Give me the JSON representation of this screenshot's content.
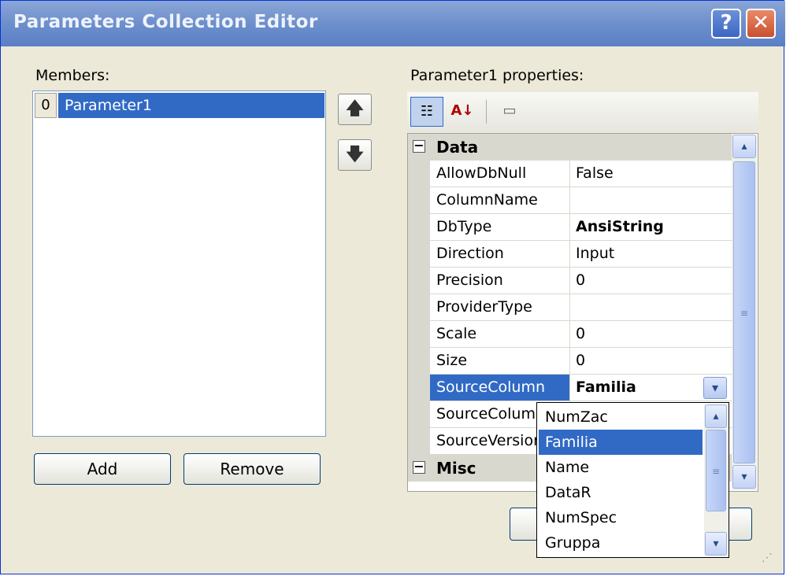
{
  "window": {
    "title": "Parameters Collection Editor",
    "help_glyph": "?",
    "close_glyph": "✕"
  },
  "members": {
    "label": "Members:",
    "items": [
      {
        "index": "0",
        "name": "Parameter1"
      }
    ],
    "add_label": "Add",
    "remove_label": "Remove"
  },
  "properties": {
    "label": "Parameter1 properties:",
    "categories": [
      {
        "name": "Data",
        "toggle": "⊟"
      },
      {
        "name": "Misc",
        "toggle": "⊟"
      }
    ],
    "rows": [
      {
        "name": "AllowDbNull",
        "value": "False"
      },
      {
        "name": "ColumnName",
        "value": ""
      },
      {
        "name": "DbType",
        "value": "AnsiString"
      },
      {
        "name": "Direction",
        "value": "Input"
      },
      {
        "name": "Precision",
        "value": "0"
      },
      {
        "name": "ProviderType",
        "value": ""
      },
      {
        "name": "Scale",
        "value": "0"
      },
      {
        "name": "Size",
        "value": "0"
      },
      {
        "name": "SourceColumn",
        "value": "Familia"
      },
      {
        "name": "SourceColumnNullMapping",
        "value": ""
      },
      {
        "name": "SourceVersion",
        "value": ""
      }
    ]
  },
  "dropdown": {
    "options": [
      "NumZac",
      "Familia",
      "Name",
      "DataR",
      "NumSpec",
      "Gruppa"
    ],
    "selected": "Familia"
  },
  "icons": {
    "move_up": "🡅",
    "move_down": "🡇",
    "categorized": "☷",
    "alphabetical": "A↓",
    "property_pages": "▭",
    "dropdown_arrow": "▾",
    "scroll_up": "▴",
    "scroll_down": "▾",
    "scroll_grip": "≡"
  },
  "colors": {
    "selection": "#316ac5",
    "titlebar": "#6d8fcc",
    "dialog": "#ece9d8"
  }
}
